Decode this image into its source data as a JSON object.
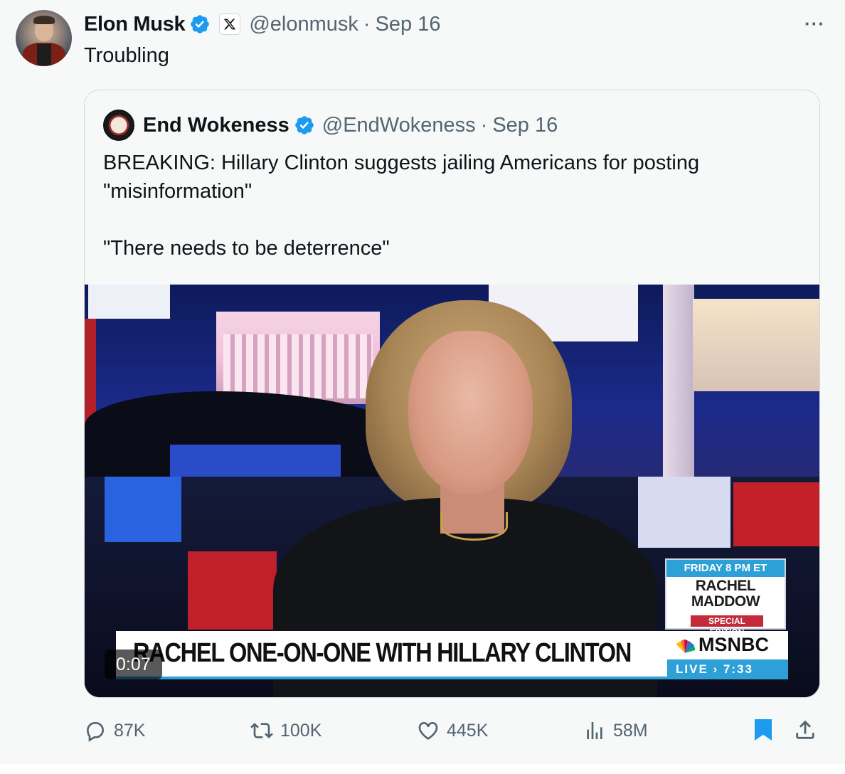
{
  "tweet": {
    "author_name": "Elon Musk",
    "author_handle": "@elonmusk",
    "date": "Sep 16",
    "separator": "·",
    "text": "Troubling",
    "more_label": "···"
  },
  "quote": {
    "author_name": "End Wokeness",
    "author_handle": "@EndWokeness",
    "date": "Sep 16",
    "separator": "·",
    "text_line1": "BREAKING: Hillary Clinton suggests jailing Americans for posting \"misinformation\"",
    "text_line2": "\"There needs to be deterrence\"",
    "video": {
      "duration": "0:07",
      "chyron_text": "RACHEL ONE-ON-ONE WITH HILLARY CLINTON",
      "network": "MSNBC",
      "live_label": "LIVE",
      "live_time": "7:33",
      "promo_top": "FRIDAY 8 PM ET",
      "promo_title_1": "RACHEL",
      "promo_title_2": "MADDOW",
      "promo_bottom": "SPECIAL EDITION"
    }
  },
  "actions": {
    "replies": "87K",
    "reposts": "100K",
    "likes": "445K",
    "views": "58M"
  },
  "colors": {
    "verified": "#1d9bf0",
    "muted": "#536471",
    "bookmark_active": "#1d9bf0",
    "background": "#f7f9f9"
  },
  "icons": [
    "verified-badge-icon",
    "x-logo-icon",
    "more-icon",
    "reply-icon",
    "repost-icon",
    "like-icon",
    "views-icon",
    "bookmark-icon",
    "share-icon"
  ]
}
